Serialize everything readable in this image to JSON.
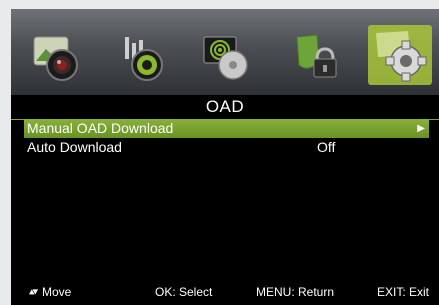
{
  "icons": [
    {
      "name": "picture-icon"
    },
    {
      "name": "sound-icon"
    },
    {
      "name": "channel-icon"
    },
    {
      "name": "lock-icon"
    },
    {
      "name": "setup-gear-icon",
      "active": true
    }
  ],
  "title": "OAD",
  "items": [
    {
      "label": "Manual OAD Download",
      "value": "",
      "arrow": "▶",
      "selected": true
    },
    {
      "label": "Auto Download",
      "value": "Off",
      "arrow": "",
      "selected": false
    }
  ],
  "footer": {
    "move_symbol": "▴▾",
    "move": "Move",
    "ok": "OK: Select",
    "menu": "MENU: Return",
    "exit": "EXIT: Exit"
  },
  "colors": {
    "highlight": "#76a22c",
    "background": "#000000",
    "text": "#ffffff"
  }
}
